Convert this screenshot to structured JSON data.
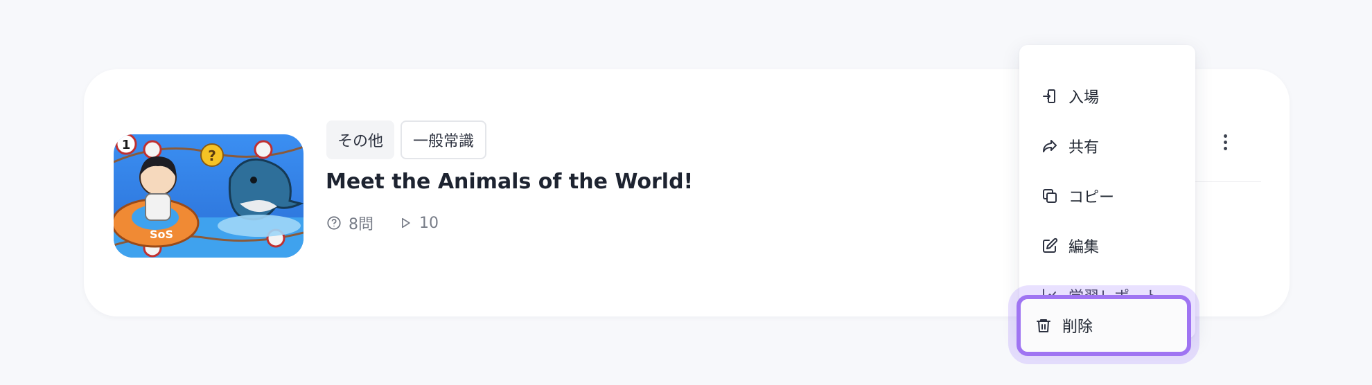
{
  "quiz_card": {
    "tags": [
      "その他",
      "一般常識"
    ],
    "title": "Meet the Animals of the World!",
    "question_count": "8問",
    "play_count": "10",
    "thumbnail_icon": "pixel-art-dolphin-lifebuoy-thumbnail"
  },
  "context_menu": {
    "items": [
      {
        "label": "入場",
        "icon": "enter-icon"
      },
      {
        "label": "共有",
        "icon": "share-icon"
      },
      {
        "label": "コピー",
        "icon": "copy-icon"
      },
      {
        "label": "編集",
        "icon": "edit-icon"
      },
      {
        "label": "学習レポート",
        "icon": "report-chart-icon"
      },
      {
        "label": "削除",
        "icon": "trash-icon"
      }
    ],
    "highlight_color": "#9f74f2"
  },
  "colors": {
    "background": "#f7f8fb",
    "card": "#ffffff",
    "text": "#1d2330",
    "muted": "#777c87"
  }
}
